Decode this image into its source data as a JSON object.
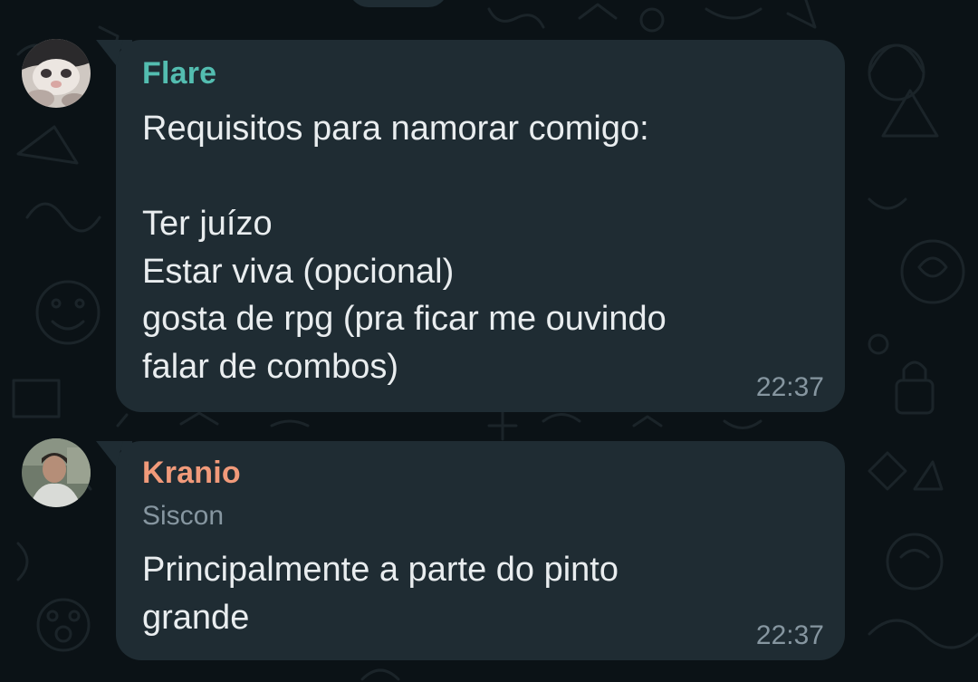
{
  "colors": {
    "background": "#0b1216",
    "bubble": "#1f2c33",
    "text": "#e9edef",
    "meta": "#8696a0"
  },
  "messages": [
    {
      "sender": "Flare",
      "sender_color": "#53bdb0",
      "avatar": "cat-photo-avatar",
      "text": "Requisitos para namorar comigo:\n\nTer juízo\nEstar viva (opcional)\ngosta de rpg (pra ficar me ouvindo\nfalar de combos)",
      "time": "22:37"
    },
    {
      "sender": "Kranio",
      "sender_color": "#f19a7a",
      "subtitle": "Siscon",
      "avatar": "person-photo-avatar",
      "text": "Principalmente a parte do pinto\ngrande",
      "time": "22:37"
    }
  ]
}
